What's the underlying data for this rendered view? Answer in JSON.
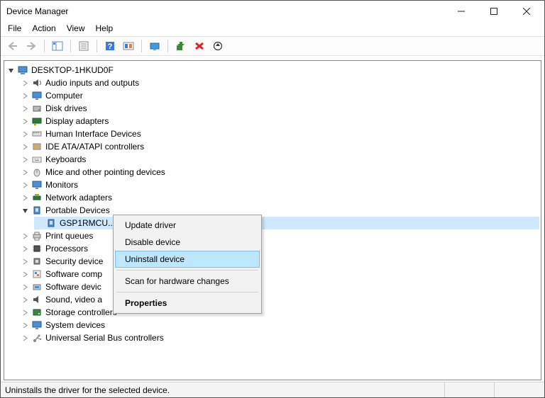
{
  "window": {
    "title": "Device Manager"
  },
  "menu": {
    "file": "File",
    "action": "Action",
    "view": "View",
    "help": "Help"
  },
  "tree": {
    "root": "DESKTOP-1HKUD0F",
    "audio": "Audio inputs and outputs",
    "computer": "Computer",
    "disk": "Disk drives",
    "display": "Display adapters",
    "hid": "Human Interface Devices",
    "ide": "IDE ATA/ATAPI controllers",
    "keyboards": "Keyboards",
    "mice": "Mice and other pointing devices",
    "monitors": "Monitors",
    "network": "Network adapters",
    "portable": "Portable Devices",
    "portable_child": "GSP1RMCU...",
    "printq": "Print queues",
    "processors": "Processors",
    "security": "Security device",
    "swcomp": "Software comp",
    "swdev": "Software devic",
    "sound": "Sound, video a",
    "storage": "Storage controllers",
    "system": "System devices",
    "usb": "Universal Serial Bus controllers"
  },
  "context_menu": {
    "update": "Update driver",
    "disable": "Disable device",
    "uninstall": "Uninstall device",
    "scan": "Scan for hardware changes",
    "properties": "Properties"
  },
  "status": {
    "text": "Uninstalls the driver for the selected device."
  }
}
